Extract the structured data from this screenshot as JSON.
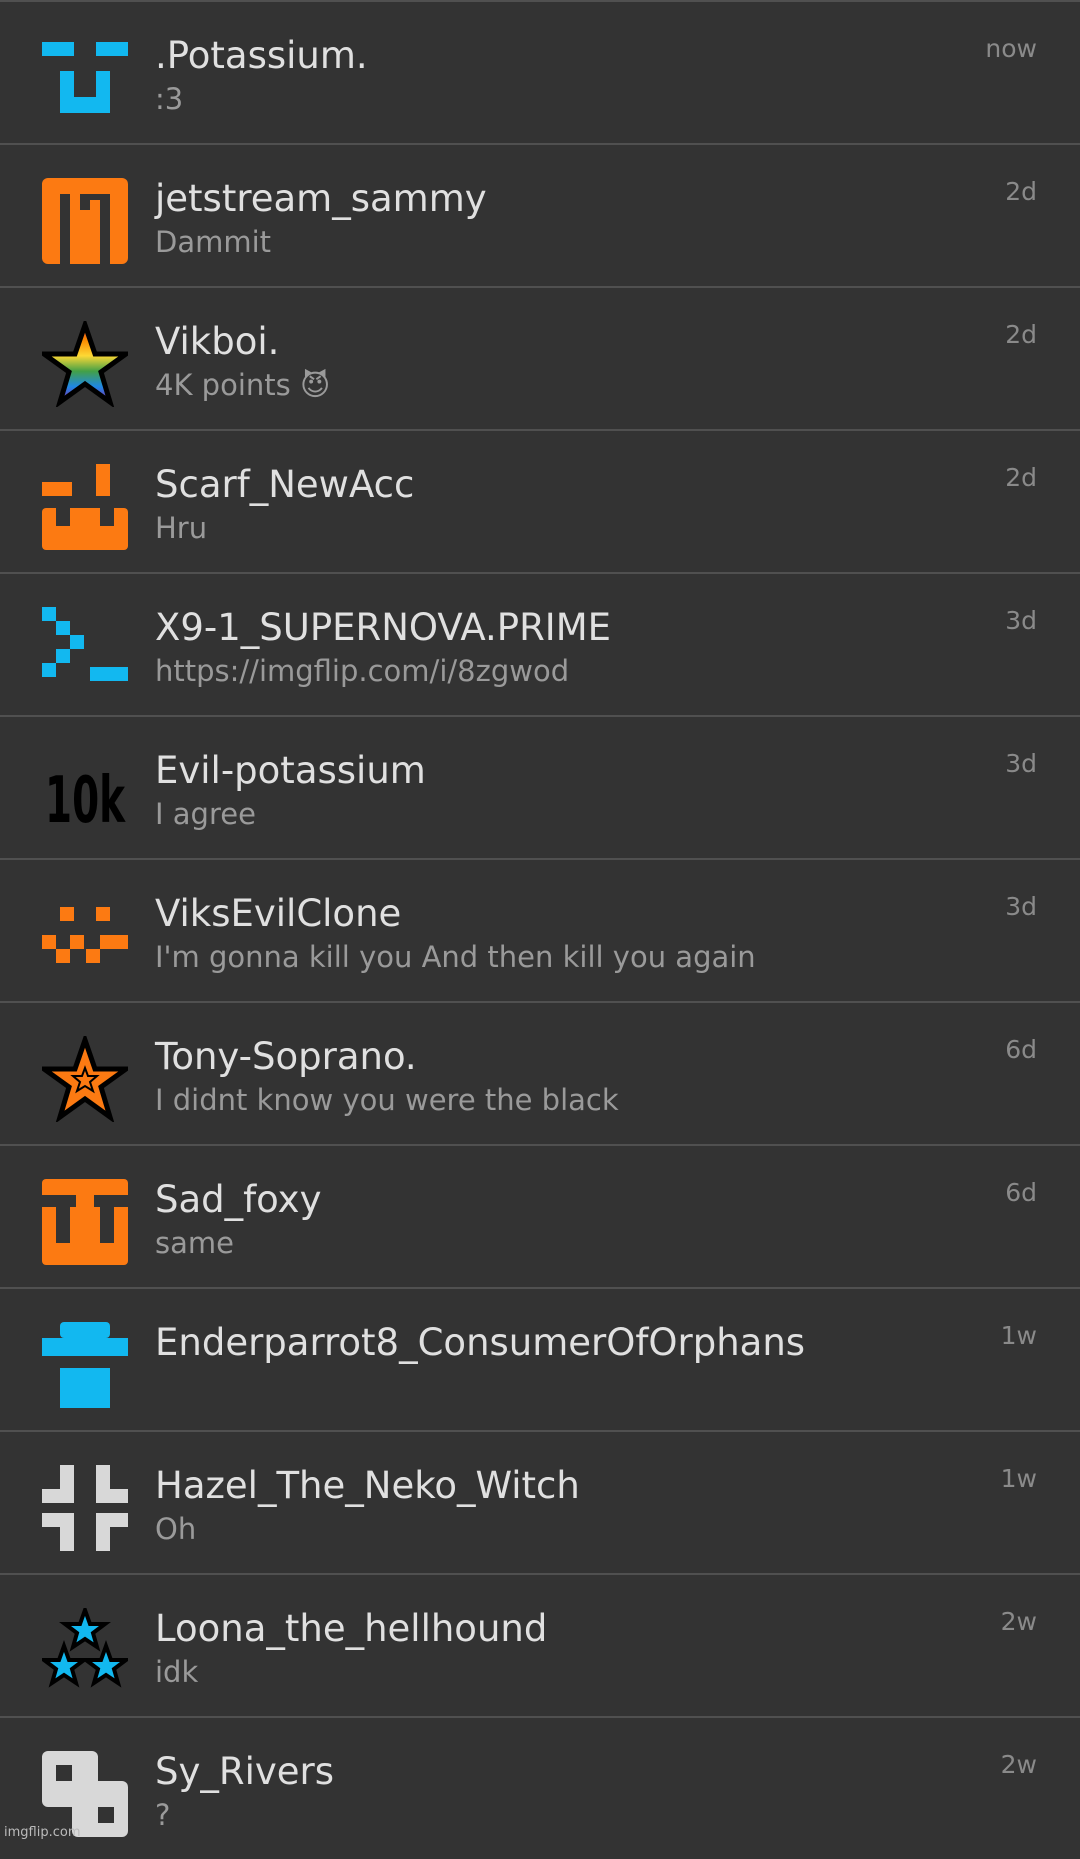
{
  "colors": {
    "background": "#333333",
    "divider": "#505050",
    "name_text": "#e0e0e0",
    "message_text": "#9a9a9a",
    "time_text": "#8a8a8a",
    "avatar_blue": "#12b8f0",
    "avatar_orange": "#fc7a12",
    "avatar_white": "#d8d8d8"
  },
  "conversations": [
    {
      "name": ".Potassium.",
      "message": ":3",
      "time": "now",
      "avatar": "blue-pixel-face-icon"
    },
    {
      "name": "jetstream_sammy",
      "message": "Dammit",
      "time": "2d",
      "avatar": "orange-pixel-face-icon"
    },
    {
      "name": "Vikboi.",
      "message": "4K points 😈",
      "time": "2d",
      "avatar": "rainbow-star-icon"
    },
    {
      "name": "Scarf_NewAcc",
      "message": "Hru",
      "time": "2d",
      "avatar": "orange-pixel-face-icon"
    },
    {
      "name": "X9-1_SUPERNOVA.PRIME",
      "message": "https://imgflip.com/i/8zgwod",
      "time": "3d",
      "avatar": "blue-terminal-prompt-icon"
    },
    {
      "name": "Evil-potassium",
      "message": "I agree",
      "time": "3d",
      "avatar": "10k-text-icon",
      "avatar_text": "10k"
    },
    {
      "name": "ViksEvilClone",
      "message": "I'm gonna kill you And then kill you again",
      "time": "3d",
      "avatar": "orange-checker-face-icon"
    },
    {
      "name": "Tony-Soprano.",
      "message": "I didnt know you were the black",
      "time": "6d",
      "avatar": "orange-star-icon"
    },
    {
      "name": "Sad_foxy",
      "message": "same",
      "time": "6d",
      "avatar": "orange-pixel-face-icon"
    },
    {
      "name": "Enderparrot8_ConsumerOfOrphans",
      "message": "",
      "time": "1w",
      "avatar": "blue-pixel-face-icon"
    },
    {
      "name": "Hazel_The_Neko_Witch",
      "message": "Oh",
      "time": "1w",
      "avatar": "white-pixel-face-icon"
    },
    {
      "name": "Loona_the_hellhound",
      "message": "idk",
      "time": "2w",
      "avatar": "three-blue-stars-icon"
    },
    {
      "name": "Sy_Rivers",
      "message": "?",
      "time": "2w",
      "avatar": "white-blocks-icon"
    }
  ],
  "watermark": "imgflip.com"
}
